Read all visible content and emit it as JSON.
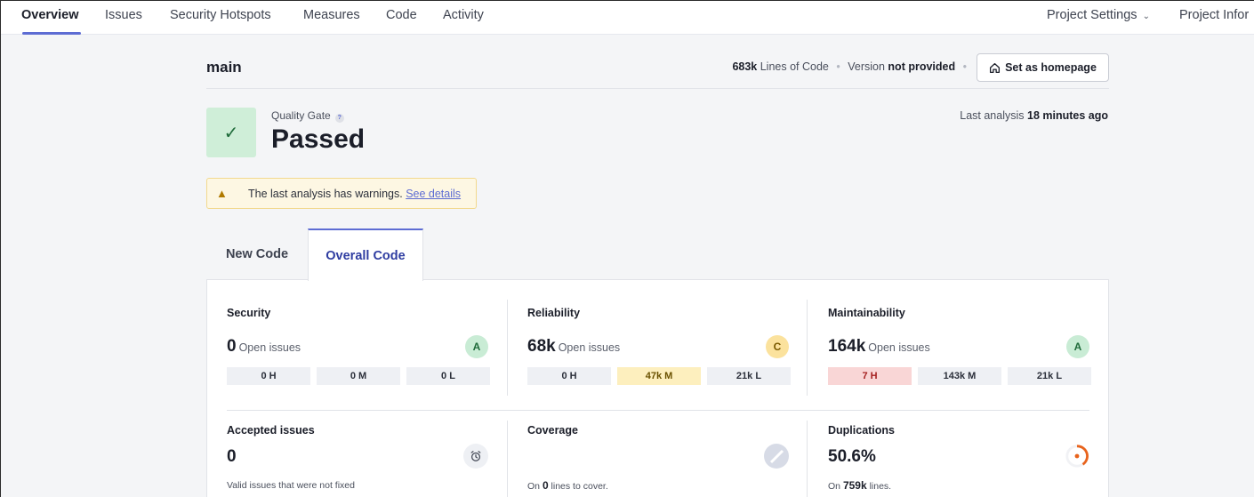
{
  "nav": {
    "tabs": [
      "Overview",
      "Issues",
      "Security Hotspots",
      "Measures",
      "Code",
      "Activity"
    ],
    "right": [
      "Project Settings",
      "Project Infor"
    ]
  },
  "header": {
    "branch": "main",
    "loc_value": "683k",
    "loc_label": "Lines of Code",
    "version_label": "Version",
    "version_value": "not provided",
    "homepage_button": "Set as homepage"
  },
  "quality_gate": {
    "label": "Quality Gate",
    "help": "?",
    "status": "Passed",
    "last_analysis_label": "Last analysis",
    "last_analysis_value": "18 minutes ago"
  },
  "warning": {
    "text": "The last analysis has warnings.",
    "link": "See details"
  },
  "code_tabs": [
    "New Code",
    "Overall Code"
  ],
  "metrics": {
    "security": {
      "title": "Security",
      "value": "0",
      "suffix": "Open issues",
      "grade": "A",
      "h": "0 H",
      "m": "0 M",
      "l": "0 L"
    },
    "reliability": {
      "title": "Reliability",
      "value": "68k",
      "suffix": "Open issues",
      "grade": "C",
      "h": "0 H",
      "m": "47k M",
      "l": "21k L"
    },
    "maintainability": {
      "title": "Maintainability",
      "value": "164k",
      "suffix": "Open issues",
      "grade": "A",
      "h": "7 H",
      "m": "143k M",
      "l": "21k L"
    },
    "accepted": {
      "title": "Accepted issues",
      "value": "0",
      "note": "Valid issues that were not fixed"
    },
    "coverage": {
      "title": "Coverage",
      "note_pre": "On",
      "note_val": "0",
      "note_post": "lines to cover."
    },
    "duplications": {
      "title": "Duplications",
      "value": "50.6%",
      "note_pre": "On",
      "note_val": "759k",
      "note_post": "lines."
    }
  },
  "colors": {
    "accent": "#5d6cd3",
    "pass": "#cfeed8",
    "warn_bg": "#fdf7e3",
    "high": "#f9d6d6",
    "medium": "#fdefbe"
  }
}
